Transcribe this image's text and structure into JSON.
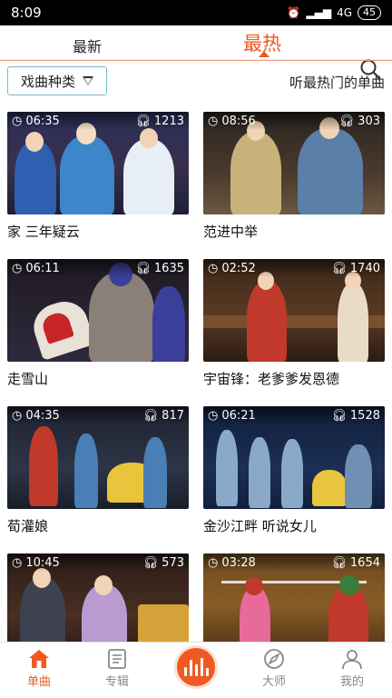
{
  "status": {
    "time": "8:09",
    "network": "4G",
    "battery": "45"
  },
  "tabs": {
    "latest": "最新",
    "hot": "最热"
  },
  "filter": {
    "label": "戏曲种类",
    "hint": "听最热门的单曲"
  },
  "songs": [
    {
      "duration": "06:35",
      "listens": "1213",
      "title": "家 三年疑云"
    },
    {
      "duration": "08:56",
      "listens": "303",
      "title": "范进中举"
    },
    {
      "duration": "06:11",
      "listens": "1635",
      "title": "走雪山"
    },
    {
      "duration": "02:52",
      "listens": "1740",
      "title": "宇宙锋：老爹爹发恩德"
    },
    {
      "duration": "04:35",
      "listens": "817",
      "title": "荀灌娘"
    },
    {
      "duration": "06:21",
      "listens": "1528",
      "title": "金沙江畔 听说女儿"
    },
    {
      "duration": "10:45",
      "listens": "573",
      "title": ""
    },
    {
      "duration": "03:28",
      "listens": "1654",
      "title": ""
    }
  ],
  "bottom_nav": {
    "singles": "单曲",
    "albums": "专辑",
    "masters": "大师",
    "mine": "我的"
  },
  "colors": {
    "accent": "#f05a22"
  }
}
